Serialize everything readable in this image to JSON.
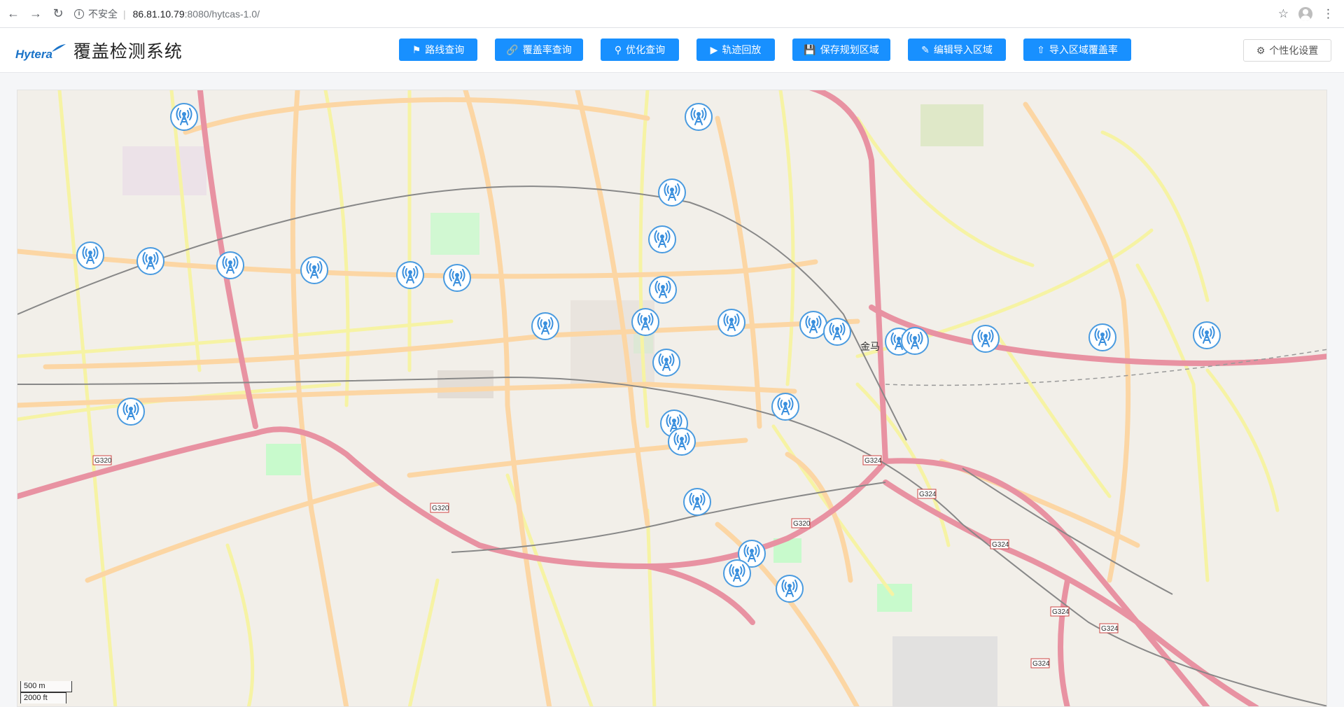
{
  "browser": {
    "security_label": "不安全",
    "url_host": "86.81.10.79",
    "url_path": ":8080/hytcas-1.0/"
  },
  "app": {
    "logo": "Hytera",
    "title": "覆盖检测系统"
  },
  "toolbar": {
    "buttons": [
      {
        "label": "路线查询",
        "icon": "flag-icon"
      },
      {
        "label": "覆盖率查询",
        "icon": "link-icon"
      },
      {
        "label": "优化查询",
        "icon": "bell-icon"
      },
      {
        "label": "轨迹回放",
        "icon": "play-circle-icon"
      },
      {
        "label": "保存规划区域",
        "icon": "save-icon"
      },
      {
        "label": "编辑导入区域",
        "icon": "edit-icon"
      },
      {
        "label": "导入区域覆盖率",
        "icon": "upload-icon"
      }
    ],
    "settings_label": "个性化设置"
  },
  "map": {
    "place_label": "金马",
    "road_labels": [
      "G320",
      "G320",
      "G320",
      "G324",
      "G324",
      "G324",
      "G324",
      "G324",
      "G324"
    ],
    "scale_metric": "500 m",
    "scale_imperial": "2000 ft",
    "tower_count": 30
  }
}
